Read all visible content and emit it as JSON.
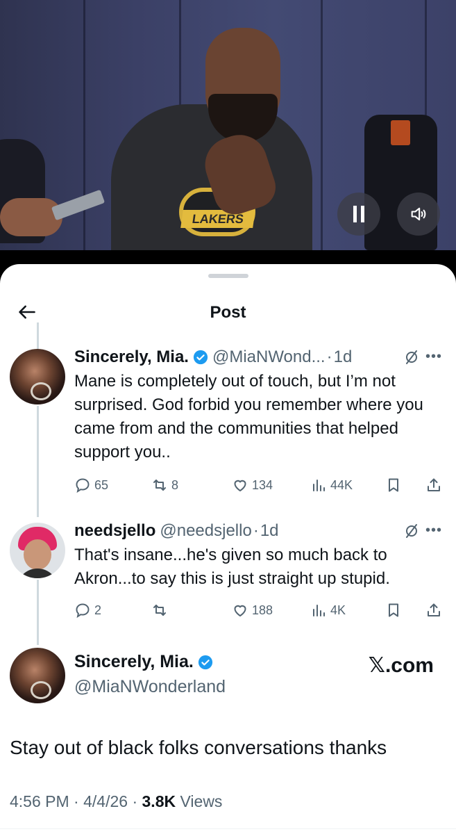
{
  "header": {
    "title": "Post"
  },
  "video": {
    "controls": [
      "pause-icon",
      "speaker-icon"
    ],
    "shirt_text": "LAKERS"
  },
  "replies": [
    {
      "name": "Sincerely, Mia.",
      "verified": true,
      "handle": "@MiaNWond...",
      "time": "1d",
      "text": "Mane is completely out of touch, but I’m not surprised. God forbid you remember where you came from and the communities that helped support you..",
      "stats": {
        "replies": "65",
        "reposts": "8",
        "likes": "134",
        "views": "44K"
      }
    },
    {
      "name": "needsjello",
      "verified": false,
      "handle": "@needsjello",
      "time": "1d",
      "text": "That's insane...he's given so much back to Akron...to say this is just straight up stupid.",
      "stats": {
        "replies": "2",
        "reposts": "",
        "likes": "188",
        "views": "4K"
      }
    }
  ],
  "main_post": {
    "name": "Sincerely, Mia.",
    "handle": "@MiaNWonderland",
    "watermark": "𝕏.com",
    "text": "Stay out of black folks conversations thanks",
    "time": "4:56 PM",
    "date": "4/4/26",
    "views_count": "3.8K",
    "views_label": "Views"
  },
  "colors": {
    "verified": "#1d9bf0",
    "secondary_text": "#536471",
    "text": "#0f1419"
  }
}
